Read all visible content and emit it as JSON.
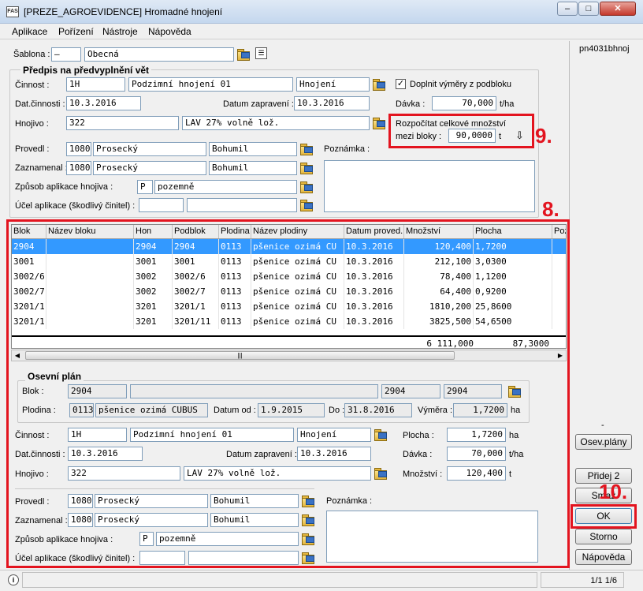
{
  "window": {
    "title": "[PREZE_AGROEVIDENCE] Hromadné hnojení",
    "app_icon": "FAS",
    "id": "pn4031bhnoj"
  },
  "menu": [
    "Aplikace",
    "Pořízení",
    "Nástroje",
    "Nápověda"
  ],
  "sablona": {
    "label": "Šablona :",
    "code": "–",
    "name": "Obecná"
  },
  "predpis": {
    "title": "Předpis na předvyplnění vět",
    "cinnost": {
      "label": "Činnost :",
      "code": "1H",
      "name": "Podzimní hnojení 01",
      "type": "Hnojení"
    },
    "doplnit": {
      "label": "Doplnit výměry z podbloku",
      "checked": "✓"
    },
    "dat_cinnosti": {
      "label": "Dat.činnosti :",
      "value": "10.3.2016"
    },
    "datum_zapraveni": {
      "label": "Datum zapravení :",
      "value": "10.3.2016"
    },
    "davka": {
      "label": "Dávka :",
      "value": "70,000",
      "unit": "t/ha"
    },
    "hnojivo": {
      "label": "Hnojivo :",
      "code": "322",
      "name": "LAV 27% volně lož."
    },
    "rozpocitat": {
      "line1": "Rozpočítat celkové množství",
      "line2": "mezi bloky :",
      "value": "90,0000",
      "unit": "t"
    },
    "provedl": {
      "label": "Provedl :",
      "code": "1080",
      "surname": "Prosecký",
      "name": "Bohumil"
    },
    "zaznamenal": {
      "label": "Zaznamenal :",
      "code": "1080",
      "surname": "Prosecký",
      "name": "Bohumil"
    },
    "zpusob": {
      "label": "Způsob aplikace hnojiva :",
      "code": "P",
      "name": "pozemně"
    },
    "ucel": {
      "label": "Účel aplikace (škodlivý činitel) :"
    },
    "poznamka": {
      "label": "Poznámka :"
    }
  },
  "annotations": {
    "nine": "9.",
    "eight": "8.",
    "ten": "10."
  },
  "grid": {
    "columns": [
      "Blok",
      "Název bloku",
      "Hon",
      "Podblok",
      "Plodina",
      "Název plodiny",
      "Datum proved.",
      "Množství",
      "Plocha",
      "Poz"
    ],
    "rows": [
      {
        "blok": "2904",
        "nazev": "",
        "hon": "2904",
        "podblok": "2904",
        "plodina": "0113",
        "nazev_plodiny": "pšenice ozimá CU",
        "datum": "10.3.2016",
        "mnozstvi": "120,400",
        "plocha": "1,7200"
      },
      {
        "blok": "3001",
        "nazev": "",
        "hon": "3001",
        "podblok": "3001",
        "plodina": "0113",
        "nazev_plodiny": "pšenice ozimá CU",
        "datum": "10.3.2016",
        "mnozstvi": "212,100",
        "plocha": "3,0300"
      },
      {
        "blok": "3002/6",
        "nazev": "",
        "hon": "3002",
        "podblok": "3002/6",
        "plodina": "0113",
        "nazev_plodiny": "pšenice ozimá CU",
        "datum": "10.3.2016",
        "mnozstvi": "78,400",
        "plocha": "1,1200"
      },
      {
        "blok": "3002/7",
        "nazev": "",
        "hon": "3002",
        "podblok": "3002/7",
        "plodina": "0113",
        "nazev_plodiny": "pšenice ozimá CU",
        "datum": "10.3.2016",
        "mnozstvi": "64,400",
        "plocha": "0,9200"
      },
      {
        "blok": "3201/1",
        "nazev": "",
        "hon": "3201",
        "podblok": "3201/1",
        "plodina": "0113",
        "nazev_plodiny": "pšenice ozimá CU",
        "datum": "10.3.2016",
        "mnozstvi": "1810,200",
        "plocha": "25,8600"
      },
      {
        "blok": "3201/1",
        "nazev": "",
        "hon": "3201",
        "podblok": "3201/11",
        "plodina": "0113",
        "nazev_plodiny": "pšenice ozimá CU",
        "datum": "10.3.2016",
        "mnozstvi": "3825,500",
        "plocha": "54,6500"
      }
    ],
    "total_mnozstvi": "6 111,000",
    "total_plocha": "87,3000",
    "scroll_grip": "|||"
  },
  "osevni": {
    "title": "Osevní plán",
    "blok": {
      "label": "Blok :",
      "value": "2904",
      "name": "",
      "hon": "2904",
      "podblok": "2904"
    },
    "plodina": {
      "label": "Plodina :",
      "code": "0113",
      "name": "pšenice ozimá CUBUS"
    },
    "datum_od": {
      "label": "Datum od :",
      "value": "1.9.2015"
    },
    "do": {
      "label": "Do :",
      "value": "31.8.2016"
    },
    "vymera": {
      "label": "Výměra :",
      "value": "1,7200",
      "unit": "ha"
    }
  },
  "detail": {
    "cinnost": {
      "label": "Činnost :",
      "code": "1H",
      "name": "Podzimní hnojení 01",
      "type": "Hnojení"
    },
    "plocha": {
      "label": "Plocha :",
      "value": "1,7200",
      "unit": "ha"
    },
    "dat_cinnosti": {
      "label": "Dat.činnosti :",
      "value": "10.3.2016"
    },
    "datum_zapraveni": {
      "label": "Datum zapravení :",
      "value": "10.3.2016"
    },
    "davka": {
      "label": "Dávka :",
      "value": "70,000",
      "unit": "t/ha"
    },
    "hnojivo": {
      "label": "Hnojivo :",
      "code": "322",
      "name": "LAV 27% volně lož."
    },
    "mnozstvi": {
      "label": "Množství :",
      "value": "120,400",
      "unit": "t"
    },
    "provedl": {
      "label": "Provedl :",
      "code": "1080",
      "surname": "Prosecký",
      "name": "Bohumil"
    },
    "zaznamenal": {
      "label": "Zaznamenal :",
      "code": "1080",
      "surname": "Prosecký",
      "name": "Bohumil"
    },
    "zpusob": {
      "label": "Způsob aplikace hnojiva :",
      "code": "P",
      "name": "pozemně"
    },
    "ucel": {
      "label": "Účel aplikace (škodlivý činitel) :"
    },
    "poznamka": {
      "label": "Poznámka :"
    }
  },
  "buttons": {
    "dash": "-",
    "osev_plany": "Osev.plány",
    "pridej": "Přidej 2",
    "smaz": "Smaž",
    "ok": "OK",
    "storno": "Storno",
    "napoveda": "Nápověda"
  },
  "status": {
    "left": "i",
    "pages": "1/1 1/6"
  },
  "colors": {
    "accent": "#3399ff",
    "annotation": "#e3141f"
  }
}
